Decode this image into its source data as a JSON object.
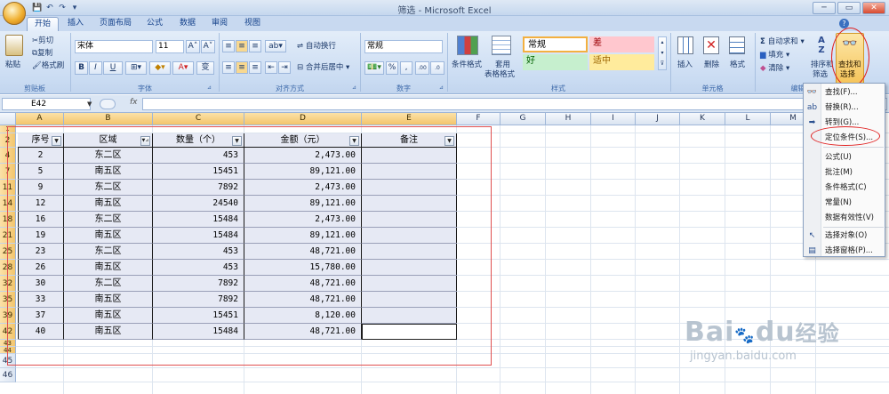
{
  "window": {
    "title": "筛选 - Microsoft Excel",
    "min": "─",
    "max": "▭",
    "close": "✕"
  },
  "tabs": [
    "开始",
    "插入",
    "页面布局",
    "公式",
    "数据",
    "审阅",
    "视图"
  ],
  "clipboard": {
    "paste": "粘贴",
    "cut": "剪切",
    "copy": "复制",
    "format_painter": "格式刷",
    "label": "剪贴板"
  },
  "font": {
    "name": "宋体",
    "size": "11",
    "grow": "A˄",
    "shrink": "A˅",
    "bold": "B",
    "italic": "I",
    "underline": "U",
    "label": "字体",
    "phonetic": "变"
  },
  "alignment": {
    "wrap": "自动换行",
    "merge": "合并后居中",
    "label": "对齐方式"
  },
  "number": {
    "format": "常规",
    "percent": "%",
    "comma": ",",
    "dec_inc": ".00",
    "dec_dec": ".0",
    "label": "数字"
  },
  "styles": {
    "conditional": "条件格式",
    "table": "套用",
    "table2": "表格格式",
    "normal": "常规",
    "bad": "差",
    "good": "好",
    "neutral": "适中",
    "label": "样式"
  },
  "cells_group": {
    "insert": "插入",
    "delete": "删除",
    "format": "格式",
    "label": "单元格"
  },
  "editing": {
    "autosum": "自动求和",
    "fill": "填充",
    "clear": "清除",
    "sort_filter": "排序和",
    "sort_filter2": "筛选",
    "find_select": "查找和",
    "find_select2": "选择",
    "label": "编辑"
  },
  "formula_bar": {
    "name_box": "E42",
    "fx": "fx"
  },
  "columns": [
    "A",
    "B",
    "C",
    "D",
    "E",
    "F",
    "G",
    "H",
    "I",
    "J",
    "K",
    "L",
    "M"
  ],
  "table": {
    "headers": [
      "序号",
      "区域",
      "数量（个）",
      "金额（元）",
      "备注"
    ],
    "rows": [
      {
        "rownum": "4",
        "seq": "2",
        "region": "东二区",
        "qty": "453",
        "amount": "2,473.00"
      },
      {
        "rownum": "7",
        "seq": "5",
        "region": "南五区",
        "qty": "15451",
        "amount": "89,121.00"
      },
      {
        "rownum": "11",
        "seq": "9",
        "region": "东二区",
        "qty": "7892",
        "amount": "2,473.00"
      },
      {
        "rownum": "14",
        "seq": "12",
        "region": "南五区",
        "qty": "24540",
        "amount": "89,121.00"
      },
      {
        "rownum": "18",
        "seq": "16",
        "region": "东二区",
        "qty": "15484",
        "amount": "2,473.00"
      },
      {
        "rownum": "21",
        "seq": "19",
        "region": "南五区",
        "qty": "15484",
        "amount": "89,121.00"
      },
      {
        "rownum": "25",
        "seq": "23",
        "region": "东二区",
        "qty": "453",
        "amount": "48,721.00"
      },
      {
        "rownum": "28",
        "seq": "26",
        "region": "南五区",
        "qty": "453",
        "amount": "15,780.00"
      },
      {
        "rownum": "32",
        "seq": "30",
        "region": "东二区",
        "qty": "7892",
        "amount": "48,721.00"
      },
      {
        "rownum": "35",
        "seq": "33",
        "region": "南五区",
        "qty": "7892",
        "amount": "48,721.00"
      },
      {
        "rownum": "39",
        "seq": "37",
        "region": "南五区",
        "qty": "15451",
        "amount": "8,120.00"
      },
      {
        "rownum": "42",
        "seq": "40",
        "region": "南五区",
        "qty": "15484",
        "amount": "48,721.00"
      }
    ],
    "top_rows": [
      "1",
      "2"
    ],
    "bottom_rows": [
      "43",
      "44",
      "45",
      "46"
    ]
  },
  "menu": [
    {
      "label": "查找(F)...",
      "icon": "binoculars-icon",
      "glyph": "👓"
    },
    {
      "label": "替换(R)...",
      "icon": "replace-icon",
      "glyph": "ab"
    },
    {
      "label": "转到(G)...",
      "icon": "goto-arrow-icon",
      "glyph": "➡"
    },
    {
      "label": "定位条件(S)...",
      "icon": "",
      "glyph": ""
    },
    {
      "label": "公式(U)",
      "icon": "",
      "glyph": ""
    },
    {
      "label": "批注(M)",
      "icon": "",
      "glyph": ""
    },
    {
      "label": "条件格式(C)",
      "icon": "",
      "glyph": ""
    },
    {
      "label": "常量(N)",
      "icon": "",
      "glyph": ""
    },
    {
      "label": "数据有效性(V)",
      "icon": "",
      "glyph": ""
    },
    {
      "label": "选择对象(O)",
      "icon": "select-objects-icon",
      "glyph": "↖"
    },
    {
      "label": "选择窗格(P)...",
      "icon": "selection-pane-icon",
      "glyph": "▤"
    }
  ],
  "watermark": {
    "brand": "Bai",
    "brand2": "du",
    "cn": "经验",
    "url": "jingyan.baidu.com"
  },
  "colors": {
    "accent_red": "#e02020",
    "selected_header": "#f3c56c"
  }
}
